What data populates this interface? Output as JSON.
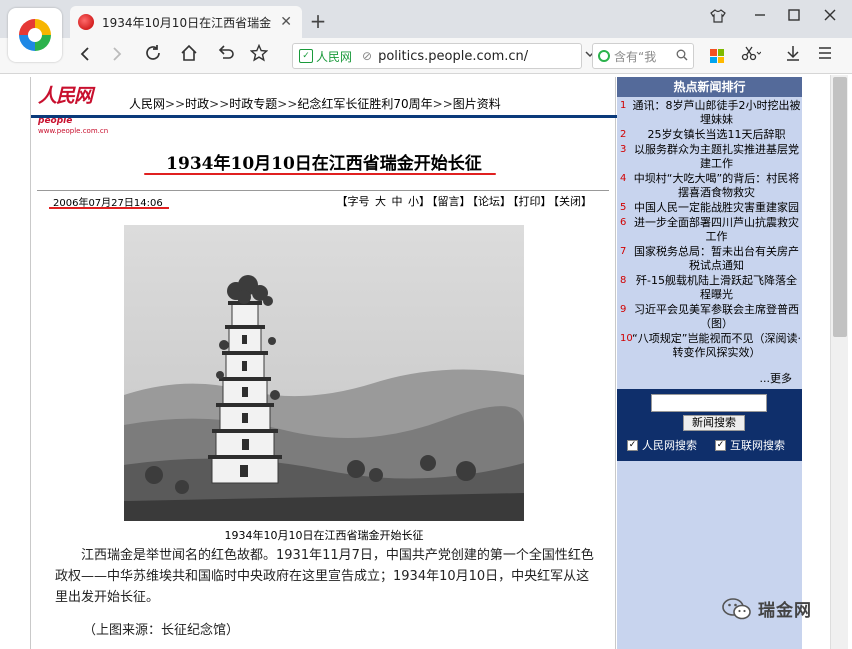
{
  "browser": {
    "tab_title": "1934年10月10日在江西省瑞金",
    "tab_close": "✕",
    "new_tab": "+",
    "address": {
      "cert_label": "人民网",
      "url": "politics.people.com.cn/"
    },
    "search_placeholder": "含有“我"
  },
  "site": {
    "logo_cn": "人民网",
    "logo_en": "people",
    "logo_url": "www.people.com.cn",
    "breadcrumb": [
      "人民网",
      "时政",
      "时政专题",
      "纪念红军长征胜利70周年",
      "图片资料"
    ],
    "breadcrumb_sep": ">>"
  },
  "article": {
    "title": "1934年10月10日在江西省瑞金开始长征",
    "date": "2006年07月27日14:06",
    "toolbar": [
      "【字号",
      "大",
      "中",
      "小】",
      "【留言】",
      "【论坛】",
      "【打印】",
      "【关闭】"
    ],
    "caption": "1934年10月10日在江西省瑞金开始长征",
    "body": "江西瑞金是举世闻名的红色故都。1931年11月7日，中国共产党创建的第一个全国性红色政权——中华苏维埃共和国临时中央政府在这里宣告成立；1934年10月10日，中央红军从这里出发开始长征。",
    "source": "（上图来源：长征纪念馆）"
  },
  "sidebar": {
    "header": "热点新闻排行",
    "items": [
      {
        "num": "1",
        "text": "通讯：8岁芦山郎徒手2小时挖出被埋妹妹"
      },
      {
        "num": "2",
        "text": "25岁女镇长当选11天后辞职"
      },
      {
        "num": "3",
        "text": "以服务群众为主题扎实推进基层党建工作"
      },
      {
        "num": "4",
        "text": "中坝村“大吃大喝”的背后：村民将摆喜酒食物救灾"
      },
      {
        "num": "5",
        "text": "中国人民一定能战胜灾害重建家园"
      },
      {
        "num": "6",
        "text": "进一步全面部署四川芦山抗震救灾工作"
      },
      {
        "num": "7",
        "text": "国家税务总局：暂未出台有关房产税试点通知"
      },
      {
        "num": "8",
        "text": "歼-15舰载机陆上滑跃起飞降落全程曝光"
      },
      {
        "num": "9",
        "text": "习近平会见美军参联会主席登普西（图）"
      },
      {
        "num": "10",
        "text": "“八项规定”岂能视而不见（深阅读·转变作风探实效）"
      }
    ],
    "more": "...更多",
    "search_button": "新闻搜索",
    "checkbox1": "人民网搜索",
    "checkbox2": "互联网搜索"
  },
  "watermark": "瑞金网"
}
